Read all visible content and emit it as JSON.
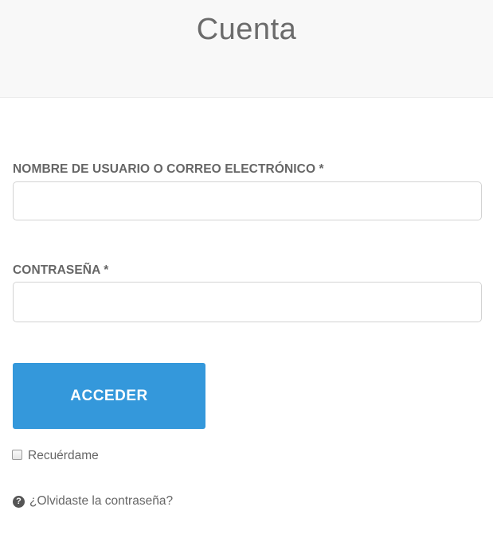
{
  "header": {
    "title": "Cuenta"
  },
  "login_form": {
    "username_label": "NOMBRE DE USUARIO O CORREO ELECTRÓNICO *",
    "username_value": "",
    "password_label": "CONTRASEÑA *",
    "password_value": "",
    "submit_label": "ACCEDER",
    "remember_label": "Recuérdame",
    "remember_checked": false,
    "forgot_link": "¿Olvidaste la contraseña?"
  },
  "icons": {
    "help": "question-circle-icon"
  },
  "colors": {
    "accent": "#3498db",
    "header_bg": "#f8f8f8"
  }
}
